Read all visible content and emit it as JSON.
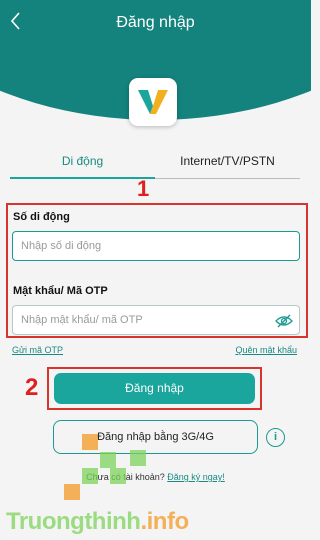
{
  "header": {
    "title": "Đăng nhập",
    "back_icon": "chevron-left-icon",
    "brand_color": "#14837d"
  },
  "logo": {
    "icon": "app-v-logo"
  },
  "tabs": [
    {
      "label": "Di động",
      "active": true
    },
    {
      "label": "Internet/TV/PSTN",
      "active": false
    }
  ],
  "form": {
    "phone_label": "Số di động",
    "phone_placeholder": "Nhập số di động",
    "phone_value": "",
    "password_label": "Mật khẩu/ Mã OTP",
    "password_placeholder": "Nhập mật khẩu/ mã OTP",
    "password_value": "",
    "eye_icon": "eye-slash-icon"
  },
  "links": {
    "send_otp": "Gửi mã OTP",
    "forgot_password": "Quên mật khẩu"
  },
  "login_button": "Đăng nhập",
  "alt_login_button": "Đăng nhập bằng 3G/4G",
  "info_icon": "i",
  "register": {
    "prompt": "Chưa có tài khoản?",
    "link": "Đăng ký ngay!"
  },
  "annotations": {
    "step1": "1",
    "step2": "2",
    "color": "#e0201e"
  },
  "watermark": {
    "text_main": "Truongthinh",
    "text_accent": ".info"
  }
}
